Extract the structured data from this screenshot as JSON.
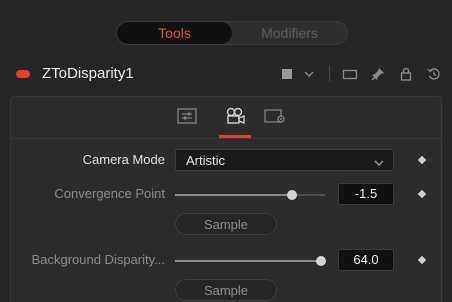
{
  "segmented": {
    "tools_label": "Tools",
    "modifiers_label": "Modifiers"
  },
  "tool": {
    "name": "ZToDisparity1",
    "status_color": "#e53f2c"
  },
  "header_icons": [
    "color-swatch-icon",
    "chevron-down-icon",
    "frame-icon",
    "pin-icon",
    "lock-icon",
    "reset-icon"
  ],
  "tabs": [
    {
      "name": "controls-tab",
      "icon": "sliders-icon"
    },
    {
      "name": "camera-tab",
      "icon": "camera-icon",
      "active": true
    },
    {
      "name": "settings-tab",
      "icon": "settings-icon"
    }
  ],
  "controls": {
    "camera_mode": {
      "label": "Camera Mode",
      "value": "Artistic"
    },
    "convergence_point": {
      "label": "Convergence Point",
      "value": "-1.5",
      "slider_fraction": 0.78
    },
    "sample_1": {
      "label": "Sample"
    },
    "background_disparity": {
      "label": "Background Disparity...",
      "value": "64.0",
      "slider_fraction": 0.97
    },
    "sample_2": {
      "label": "Sample"
    }
  },
  "colors": {
    "accent": "#e53f2c",
    "active_tab_text": "#e8563c"
  }
}
